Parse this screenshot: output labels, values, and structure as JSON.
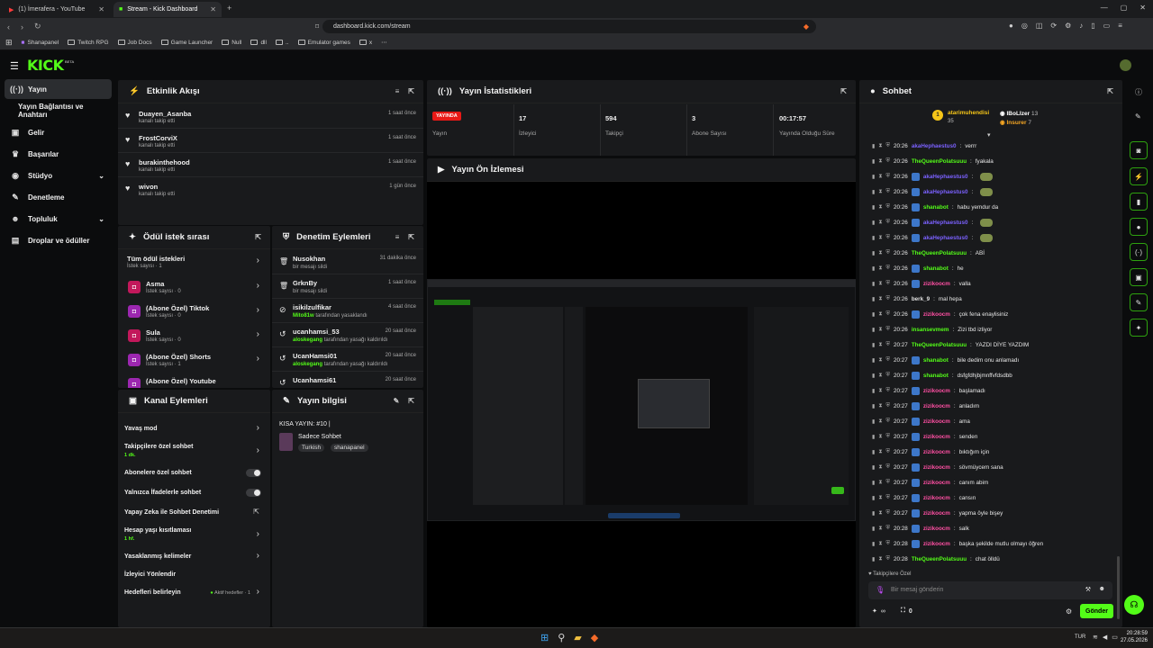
{
  "browser": {
    "tabs": [
      {
        "title": "(1) İmerafera - YouTube"
      },
      {
        "title": "Stream - Kick Dashboard"
      }
    ],
    "url": "dashboard.kick.com/stream",
    "bookmarks": [
      "Shanapanel",
      "Twitch RPG",
      "Job Docs",
      "Game Launcher",
      "Null",
      "dll",
      "..",
      "Emulator games",
      "x"
    ]
  },
  "topnav": {
    "logo": "KICK",
    "beta": "BETA"
  },
  "sidebar": {
    "items": [
      {
        "label": "Yayın",
        "icon": "broadcast-icon"
      },
      {
        "label": "Yayın Bağlantısı ve Anahtarı",
        "icon": ""
      },
      {
        "label": "Gelir",
        "icon": "money-icon"
      },
      {
        "label": "Başarılar",
        "icon": "trophy-icon"
      },
      {
        "label": "Stüdyo",
        "icon": "studio-icon"
      },
      {
        "label": "Denetleme",
        "icon": "wrench-icon"
      },
      {
        "label": "Topluluk",
        "icon": "people-icon"
      },
      {
        "label": "Droplar ve ödüller",
        "icon": "gift-icon"
      }
    ]
  },
  "activity": {
    "title": "Etkinlik Akışı",
    "items": [
      {
        "user": "Duayen_Asanba",
        "action": "kanalı takip etti",
        "time": "1 saat önce"
      },
      {
        "user": "FrostCorviX",
        "action": "kanalı takip etti",
        "time": "1 saat önce"
      },
      {
        "user": "burakinthehood",
        "action": "kanalı takip etti",
        "time": "1 saat önce"
      },
      {
        "user": "wivon",
        "action": "kanalı takip etti",
        "time": "1 gün önce"
      }
    ]
  },
  "stats": {
    "title": "Yayın İstatistikleri",
    "live_badge": "YAYINDA",
    "live_label": "Yayın",
    "cells": [
      {
        "value": "17",
        "label": "İzleyici"
      },
      {
        "value": "594",
        "label": "Takipçi"
      },
      {
        "value": "3",
        "label": "Abone Sayısı"
      },
      {
        "value": "00:17:57",
        "label": "Yayında Olduğu Süre"
      }
    ]
  },
  "preview": {
    "title": "Yayın Ön İzlemesi"
  },
  "rewards": {
    "title": "Ödül istek sırası",
    "all": {
      "label": "Tüm ödül istekleri",
      "sub": "İstek sayısı · 1"
    },
    "items": [
      {
        "label": "Asma",
        "sub": "İstek sayısı · 0",
        "color": "#c2185b"
      },
      {
        "label": "(Abone Özel) Tiktok",
        "sub": "İstek sayısı · 0",
        "color": "#9c27b0"
      },
      {
        "label": "Sula",
        "sub": "İstek sayısı · 0",
        "color": "#c2185b"
      },
      {
        "label": "(Abone Özel) Shorts",
        "sub": "İstek sayısı · 1",
        "color": "#9c27b0"
      },
      {
        "label": "(Abone Özel) Youtube",
        "sub": "",
        "color": "#9c27b0"
      }
    ]
  },
  "modactions": {
    "title": "Denetim Eylemleri",
    "items": [
      {
        "user": "Nusokhan",
        "desc": "bir mesajı sildi",
        "by": "",
        "time": "31 dakika önce",
        "icon": "trash-icon"
      },
      {
        "user": "GrknBy",
        "desc": "bir mesajı sildi",
        "by": "",
        "time": "1 saat önce",
        "icon": "trash-icon"
      },
      {
        "user": "isikilzulfikar",
        "by": "Mito81w",
        "desc": "tarafından yasaklandı",
        "time": "4 saat önce",
        "icon": "ban-icon"
      },
      {
        "user": "ucanhamsi_53",
        "by": "aloskegang",
        "desc": "tarafından yasağı kaldırıldı",
        "time": "20 saat önce",
        "icon": "unban-icon"
      },
      {
        "user": "UcanHamsi01",
        "by": "aloskegang",
        "desc": "tarafından yasağı kaldırıldı",
        "time": "20 saat önce",
        "icon": "unban-icon"
      },
      {
        "user": "Ucanhamsi61",
        "by": "",
        "desc": "",
        "time": "20 saat önce",
        "icon": "unban-icon"
      }
    ]
  },
  "channel": {
    "title": "Kanal Eylemleri",
    "items": [
      {
        "label": "Yavaş mod",
        "sub": "",
        "control": "arrow"
      },
      {
        "label": "Takipçilere özel sohbet",
        "sub": "1 dk.",
        "control": "arrow"
      },
      {
        "label": "Abonelere özel sohbet",
        "sub": "",
        "control": "toggle"
      },
      {
        "label": "Yalnızca İfadelerle sohbet",
        "sub": "",
        "control": "toggle"
      },
      {
        "label": "Yapay Zeka ile Sohbet Denetimi",
        "sub": "",
        "control": "external"
      },
      {
        "label": "Hesap yaşı kısıtlaması",
        "sub": "1 hf.",
        "control": "arrow"
      },
      {
        "label": "Yasaklanmış kelimeler",
        "sub": "",
        "control": "arrow"
      },
      {
        "label": "İzleyici Yönlendir",
        "sub": "",
        "control": "none"
      },
      {
        "label": "Hedefleri belirleyin",
        "sub": "",
        "control": "arrow",
        "extra": "Aktif hedefler · 1"
      }
    ]
  },
  "streaminfo": {
    "title": "Yayın bilgisi",
    "stream_title": "KISA YAYIN: #10 |",
    "category": "Sadece Sohbet",
    "tags": [
      "Turkish",
      "shanapanel"
    ]
  },
  "chat": {
    "title": "Sohbet",
    "leaders": [
      {
        "name": "atarimuhendisi",
        "value": "35",
        "color": "#f5c518"
      },
      {
        "name": "IBoLIzer",
        "value": "13",
        "color": "#ffffff"
      },
      {
        "name": "Insurer",
        "value": "7",
        "color": "#f5a623"
      }
    ],
    "messages": [
      {
        "time": "20:26",
        "user": "akaHephaestus0",
        "color": "#7b61ff",
        "text": "verrr",
        "bot": false,
        "emote": false
      },
      {
        "time": "20:26",
        "user": "TheQueenPolatsuuu",
        "color": "#53fc18",
        "text": "fyakala",
        "bot": false,
        "emote": false
      },
      {
        "time": "20:26",
        "user": "akaHephaestus0",
        "color": "#7b61ff",
        "text": "",
        "bot": true,
        "emote": true
      },
      {
        "time": "20:26",
        "user": "akaHephaestus0",
        "color": "#7b61ff",
        "text": "",
        "bot": true,
        "emote": true
      },
      {
        "time": "20:26",
        "user": "shanabot",
        "color": "#53fc18",
        "text": "habu yemdur da",
        "bot": true,
        "emote": false
      },
      {
        "time": "20:26",
        "user": "akaHephaestus0",
        "color": "#7b61ff",
        "text": "",
        "bot": true,
        "emote": true
      },
      {
        "time": "20:26",
        "user": "akaHephaestus0",
        "color": "#7b61ff",
        "text": "",
        "bot": true,
        "emote": true
      },
      {
        "time": "20:26",
        "user": "TheQueenPolatsuuu",
        "color": "#53fc18",
        "text": "ABİ",
        "bot": false,
        "emote": false
      },
      {
        "time": "20:26",
        "user": "shanabot",
        "color": "#53fc18",
        "text": "he",
        "bot": true,
        "emote": false
      },
      {
        "time": "20:26",
        "user": "zizikoocm",
        "color": "#ff4fa3",
        "text": "valla",
        "bot": true,
        "emote": false
      },
      {
        "time": "20:26",
        "user": "berk_9",
        "color": "#e0e0e0",
        "text": "mal hepa",
        "bot": false,
        "emote": false
      },
      {
        "time": "20:26",
        "user": "zizikoocm",
        "color": "#ff4fa3",
        "text": "çok fena enaylisiniz",
        "bot": true,
        "emote": false
      },
      {
        "time": "20:26",
        "user": "insansevmem",
        "color": "#53fc18",
        "text": "Zizi tbd izliyor",
        "bot": false,
        "emote": false
      },
      {
        "time": "20:27",
        "user": "TheQueenPolatsuuu",
        "color": "#53fc18",
        "text": "YAZDI DİYE YAZDIM",
        "bot": false,
        "emote": false
      },
      {
        "time": "20:27",
        "user": "shanabot",
        "color": "#53fc18",
        "text": "bile dedim onu anlamadı",
        "bot": true,
        "emote": false
      },
      {
        "time": "20:27",
        "user": "shanabot",
        "color": "#53fc18",
        "text": "dsfgfdhjbjmnffvfdsdbb",
        "bot": true,
        "emote": false
      },
      {
        "time": "20:27",
        "user": "zizikoocm",
        "color": "#ff4fa3",
        "text": "başlamadı",
        "bot": true,
        "emote": false
      },
      {
        "time": "20:27",
        "user": "zizikoocm",
        "color": "#ff4fa3",
        "text": "anladım",
        "bot": true,
        "emote": false
      },
      {
        "time": "20:27",
        "user": "zizikoocm",
        "color": "#ff4fa3",
        "text": "ama",
        "bot": true,
        "emote": false
      },
      {
        "time": "20:27",
        "user": "zizikoocm",
        "color": "#ff4fa3",
        "text": "senden",
        "bot": true,
        "emote": false
      },
      {
        "time": "20:27",
        "user": "zizikoocm",
        "color": "#ff4fa3",
        "text": "bıktığım için",
        "bot": true,
        "emote": false
      },
      {
        "time": "20:27",
        "user": "zizikoocm",
        "color": "#ff4fa3",
        "text": "sövmüycem sana",
        "bot": true,
        "emote": false
      },
      {
        "time": "20:27",
        "user": "zizikoocm",
        "color": "#ff4fa3",
        "text": "canım abim",
        "bot": true,
        "emote": false
      },
      {
        "time": "20:27",
        "user": "zizikoocm",
        "color": "#ff4fa3",
        "text": "cansın",
        "bot": true,
        "emote": false
      },
      {
        "time": "20:27",
        "user": "zizikoocm",
        "color": "#ff4fa3",
        "text": "yapma öyle bişey",
        "bot": true,
        "emote": false
      },
      {
        "time": "20:28",
        "user": "zizikoocm",
        "color": "#ff4fa3",
        "text": "salk",
        "bot": true,
        "emote": false
      },
      {
        "time": "20:28",
        "user": "zizikoocm",
        "color": "#ff4fa3",
        "text": "başka şekilde mutlu olmayı öğren",
        "bot": true,
        "emote": false
      },
      {
        "time": "20:28",
        "user": "TheQueenPolatsuuu",
        "color": "#53fc18",
        "text": "chat ölldü",
        "bot": false,
        "emote": false
      }
    ],
    "mode_label": "Takipçilere Özel",
    "input_placeholder": "Bir mesaj gönderin",
    "points": "∞",
    "count": "0",
    "send_label": "Gönder"
  },
  "taskbar": {
    "lang": "TUR",
    "time": "20:28:59",
    "date": "27.05.2026"
  },
  "colors": {
    "accent": "#53fc18",
    "live": "#e91916",
    "panel": "#191a1c"
  }
}
